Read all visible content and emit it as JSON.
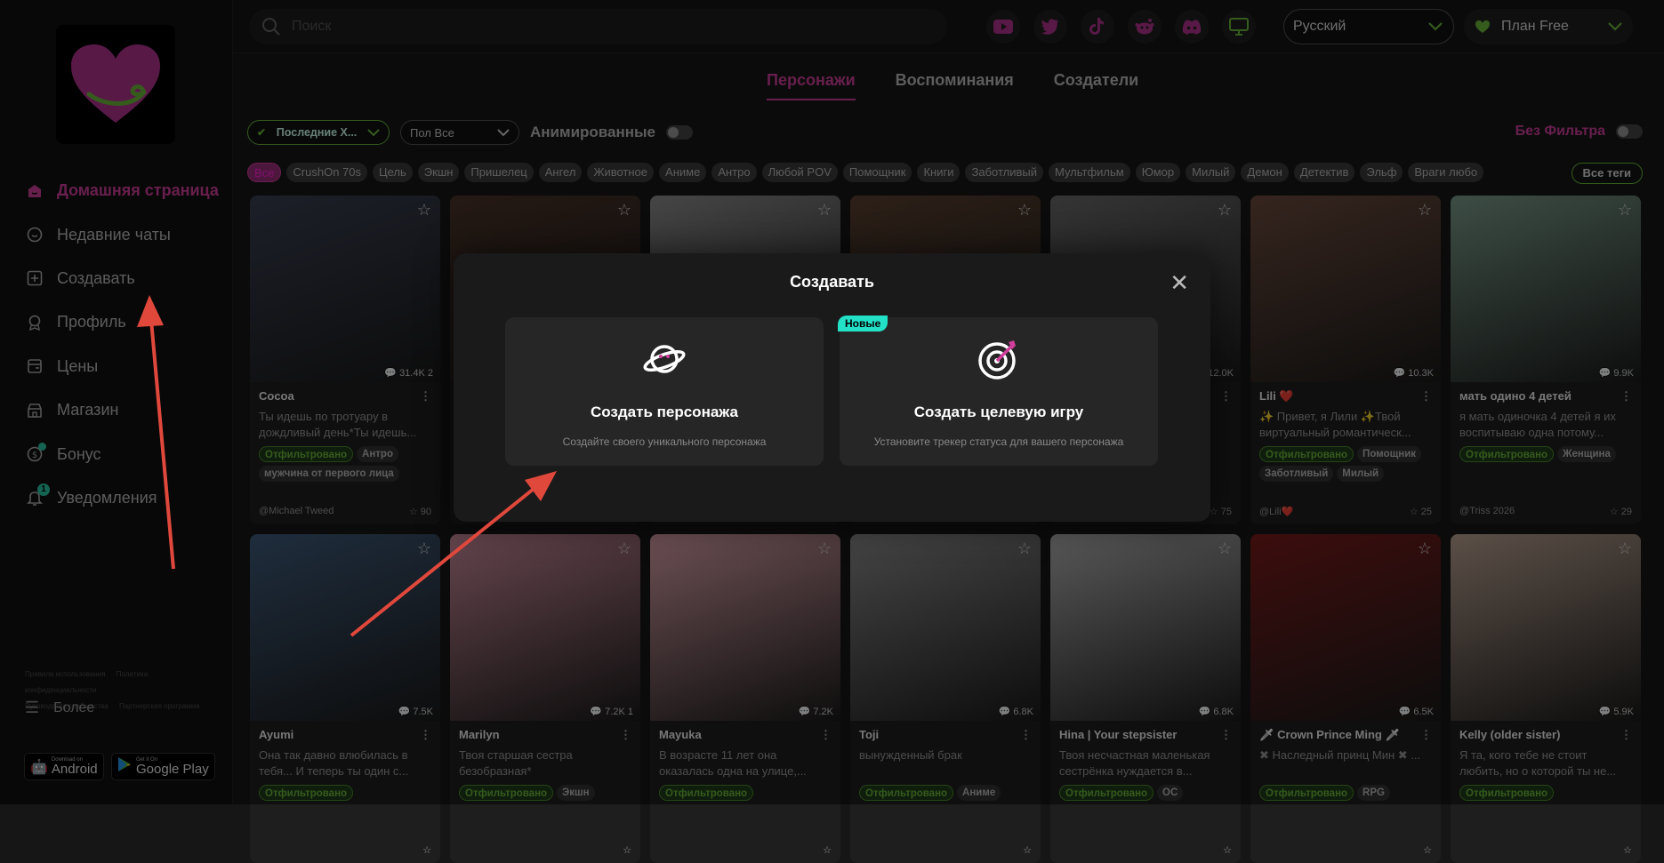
{
  "topbar": {
    "search_placeholder": "Поиск",
    "social_icons": [
      "youtube-icon",
      "twitter-icon",
      "tiktok-icon",
      "reddit-icon",
      "discord-icon",
      "desktop-icon"
    ],
    "language": "Русский",
    "plan": "План Free"
  },
  "sidebar": {
    "items": [
      {
        "label": "Домашняя страница",
        "icon": "home-icon",
        "active": true
      },
      {
        "label": "Недавние чаты",
        "icon": "chat-icon"
      },
      {
        "label": "Создавать",
        "icon": "plus-square-icon"
      },
      {
        "label": "Профиль",
        "icon": "profile-icon"
      },
      {
        "label": "Цены",
        "icon": "wallet-icon"
      },
      {
        "label": "Магазин",
        "icon": "store-icon"
      },
      {
        "label": "Бонус",
        "icon": "dollar-icon"
      },
      {
        "label": "Уведомления",
        "icon": "bell-icon",
        "badge": "1"
      }
    ],
    "legal": [
      "Правила использования",
      "Политика конфиденциальности",
      "Руководства сообщества",
      "Партнерская программа"
    ],
    "more": "Более",
    "android_small": "Download on",
    "android": "Android",
    "gplay_small": "Get it On",
    "gplay": "Google Play"
  },
  "tabs": [
    "Персонажи",
    "Воспоминания",
    "Создатели"
  ],
  "filters": {
    "sort": "Последние Х...",
    "gender": "Пол Все",
    "animated": "Анимированные",
    "no_filter": "Без Фильтра",
    "all_tags": "Все теги"
  },
  "tags": [
    "Все",
    "CrushOn 70s",
    "Цель",
    "Экшн",
    "Пришелец",
    "Ангел",
    "Животное",
    "Аниме",
    "Антро",
    "Любой POV",
    "Помощник",
    "Книги",
    "Заботливый",
    "Мультфильм",
    "Юмор",
    "Милый",
    "Демон",
    "Детектив",
    "Эльф",
    "Враги любо"
  ],
  "cards": [
    {
      "name": "Cocoa",
      "desc": "Ты идешь по тротуару в дождливый день*Ты идешь...",
      "tags": [
        "Отфильтровано",
        "Антро",
        "мужчина от первого лица"
      ],
      "author": "@Michael Tweed",
      "likes": "90",
      "stats": "31.4K",
      "extra": "2",
      "color": "#3a3f52"
    },
    {
      "name": "",
      "desc": "",
      "tags": [],
      "author": "",
      "likes": "",
      "stats": "",
      "extra": "",
      "color": "#4a3328"
    },
    {
      "name": "",
      "desc": "",
      "tags": [],
      "author": "",
      "likes": "",
      "stats": "",
      "extra": "",
      "color": "#8c8c8c"
    },
    {
      "name": "",
      "desc": "",
      "tags": [],
      "author": "",
      "likes": "",
      "stats": "",
      "extra": "",
      "color": "#5a4030"
    },
    {
      "name": "",
      "desc": "",
      "tags": [],
      "author": "",
      "likes": "75",
      "stats": "12.0K",
      "extra": "",
      "color": "#6a6a6a"
    },
    {
      "name": "Lili ❤️",
      "desc": "✨ Привет, я Лили ✨Твой виртуальный романтическ...",
      "tags": [
        "Отфильтровано",
        "Помощник",
        "Заботливый",
        "Милый"
      ],
      "author": "@Lili❤️",
      "likes": "25",
      "stats": "10.3K",
      "extra": "",
      "color": "#6b4a3c"
    },
    {
      "name": "мать одино 4 детей",
      "desc": "я мать одиночка 4 детей я их воспитываю одна потому...",
      "tags": [
        "Отфильтровано",
        "Женщина"
      ],
      "author": "@Triss 2026",
      "likes": "29",
      "stats": "9.9K",
      "extra": "",
      "color": "#7a9a8a"
    },
    {
      "name": "Ayumi",
      "desc": "Она так давно влюбилась в тебя... И теперь ты один с...",
      "tags": [
        "Отфильтровано"
      ],
      "author": "",
      "likes": "",
      "stats": "7.5K",
      "extra": "",
      "color": "#3e5a7a"
    },
    {
      "name": "Marilyn",
      "desc": "Твоя старшая сестра безобразная*",
      "tags": [
        "Отфильтровано",
        "Экшн"
      ],
      "author": "",
      "likes": "",
      "stats": "7.2K",
      "extra": "1",
      "color": "#c98a9a"
    },
    {
      "name": "Mayuka",
      "desc": "В возрасте 11 лет она оказалась одна на улице,...",
      "tags": [
        "Отфильтровано"
      ],
      "author": "",
      "likes": "",
      "stats": "7.2K",
      "extra": "",
      "color": "#d9a0a8"
    },
    {
      "name": "Toji",
      "desc": "вынужденный брак",
      "tags": [
        "Отфильтровано",
        "Аниме"
      ],
      "author": "",
      "likes": "",
      "stats": "6.8K",
      "extra": "",
      "color": "#8a8a8a"
    },
    {
      "name": "Hina | Your stepsister",
      "desc": "Твоя несчастная маленькая сестрёнка нуждается в...",
      "tags": [
        "Отфильтровано",
        "OC"
      ],
      "author": "",
      "likes": "",
      "stats": "6.8K",
      "extra": "",
      "color": "#b0b0b0"
    },
    {
      "name": "🗡 Crown Prince Ming 🗡",
      "desc": "✖ Наследный принц Мин ✖ ...",
      "tags": [
        "Отфильтровано",
        "RPG"
      ],
      "author": "",
      "likes": "",
      "stats": "6.5K",
      "extra": "",
      "color": "#7a1a1a"
    },
    {
      "name": "Kelly (older sister)",
      "desc": "Я та, кого тебе не стоит любить, но о которой ты не...",
      "tags": [
        "Отфильтровано"
      ],
      "author": "",
      "likes": "",
      "stats": "5.9K",
      "extra": "",
      "color": "#b8a090"
    }
  ],
  "modal": {
    "title": "Создавать",
    "option1_title": "Создать персонажа",
    "option1_desc": "Создайте своего уникального персонажа",
    "option2_badge": "Новые",
    "option2_title": "Создать целевую игру",
    "option2_desc": "Установите трекер статуса для вашего персонажа"
  },
  "colors": {
    "accent": "#d13e9c",
    "green": "#6ab63b",
    "teal": "#22e1c7",
    "arrow": "#e0483c"
  }
}
